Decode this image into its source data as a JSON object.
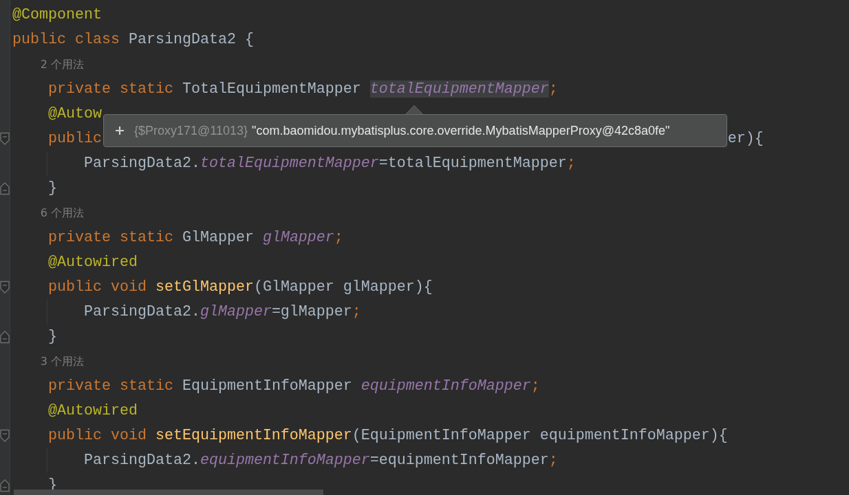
{
  "editor": {
    "lines": [
      {
        "kind": "code",
        "tokens": [
          {
            "kind": "annotation",
            "text": "@Component"
          }
        ]
      },
      {
        "kind": "code",
        "tokens": [
          {
            "kind": "keyword",
            "text": "public class "
          },
          {
            "kind": "plain",
            "text": "ParsingData2 {"
          }
        ],
        "children": [
          {
            "kind": "hint",
            "text": "2 个用法"
          },
          {
            "kind": "code",
            "tokens": [
              {
                "kind": "keyword",
                "text": "private static "
              },
              {
                "kind": "plain",
                "text": "TotalEquipmentMapper "
              },
              {
                "kind": "field",
                "text": "totalEquipmentMapper",
                "highlighted": true
              },
              {
                "kind": "punct",
                "text": ";"
              }
            ]
          },
          {
            "kind": "code",
            "tokens": [
              {
                "kind": "annotation",
                "text": "@Autow"
              }
            ]
          },
          {
            "kind": "code",
            "fold_open": true,
            "tokens": [
              {
                "kind": "keyword",
                "text": "public"
              }
            ],
            "tail": [
              {
                "kind": "plain",
                "text": "er){"
              }
            ],
            "children": [
              {
                "kind": "code",
                "tokens": [
                  {
                    "kind": "plain",
                    "text": "ParsingData2."
                  },
                  {
                    "kind": "field",
                    "text": "totalEquipmentMapper"
                  },
                  {
                    "kind": "plain",
                    "text": "=totalEquipmentMapper"
                  },
                  {
                    "kind": "punct",
                    "text": ";"
                  }
                ]
              }
            ]
          },
          {
            "kind": "code",
            "fold_close": true,
            "tokens": [
              {
                "kind": "plain",
                "text": "}"
              }
            ]
          },
          {
            "kind": "hint",
            "text": "6 个用法"
          },
          {
            "kind": "code",
            "tokens": [
              {
                "kind": "keyword",
                "text": "private static "
              },
              {
                "kind": "plain",
                "text": "GlMapper "
              },
              {
                "kind": "field",
                "text": "glMapper"
              },
              {
                "kind": "punct",
                "text": ";"
              }
            ]
          },
          {
            "kind": "code",
            "tokens": [
              {
                "kind": "annotation",
                "text": "@Autowired"
              }
            ]
          },
          {
            "kind": "code",
            "fold_open": true,
            "tokens": [
              {
                "kind": "keyword",
                "text": "public void "
              },
              {
                "kind": "method",
                "text": "setGlMapper"
              },
              {
                "kind": "plain",
                "text": "(GlMapper glMapper){"
              }
            ],
            "children": [
              {
                "kind": "code",
                "tokens": [
                  {
                    "kind": "plain",
                    "text": "ParsingData2."
                  },
                  {
                    "kind": "field",
                    "text": "glMapper"
                  },
                  {
                    "kind": "plain",
                    "text": "=glMapper"
                  },
                  {
                    "kind": "punct",
                    "text": ";"
                  }
                ]
              }
            ]
          },
          {
            "kind": "code",
            "fold_close": true,
            "tokens": [
              {
                "kind": "plain",
                "text": "}"
              }
            ]
          },
          {
            "kind": "hint",
            "text": "3 个用法"
          },
          {
            "kind": "code",
            "tokens": [
              {
                "kind": "keyword",
                "text": "private static "
              },
              {
                "kind": "plain",
                "text": "EquipmentInfoMapper "
              },
              {
                "kind": "field",
                "text": "equipmentInfoMapper"
              },
              {
                "kind": "punct",
                "text": ";"
              }
            ]
          },
          {
            "kind": "code",
            "tokens": [
              {
                "kind": "annotation",
                "text": "@Autowired"
              }
            ]
          },
          {
            "kind": "code",
            "fold_open": true,
            "tokens": [
              {
                "kind": "keyword",
                "text": "public void "
              },
              {
                "kind": "method",
                "text": "setEquipmentInfoMapper"
              },
              {
                "kind": "plain",
                "text": "(EquipmentInfoMapper equipmentInfoMapper){"
              }
            ],
            "children": [
              {
                "kind": "code",
                "tokens": [
                  {
                    "kind": "plain",
                    "text": "ParsingData2."
                  },
                  {
                    "kind": "field",
                    "text": "equipmentInfoMapper"
                  },
                  {
                    "kind": "plain",
                    "text": "=equipmentInfoMapper"
                  },
                  {
                    "kind": "punct",
                    "text": ";"
                  }
                ]
              }
            ]
          },
          {
            "kind": "code",
            "fold_close": true,
            "tokens": [
              {
                "kind": "plain",
                "text": "}"
              }
            ]
          }
        ]
      }
    ]
  },
  "tooltip": {
    "type_text": "{$Proxy171@11013}",
    "value": "\"com.baomidou.mybatisplus.core.override.MybatisMapperProxy@42c8a0fe\""
  }
}
